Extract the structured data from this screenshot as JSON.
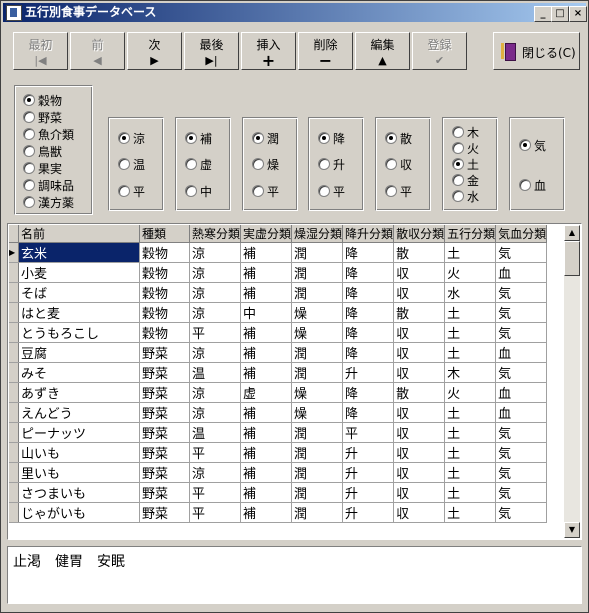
{
  "window": {
    "title": "五行別食事データベース"
  },
  "titlebar_buttons": {
    "minimize": "_",
    "maximize": "□",
    "close": "×"
  },
  "toolbar": {
    "first": {
      "label": "最初",
      "icon": "skip-first-icon",
      "disabled": true
    },
    "prev": {
      "label": "前",
      "icon": "prev-icon",
      "disabled": true
    },
    "next": {
      "label": "次",
      "icon": "next-icon",
      "disabled": false
    },
    "last": {
      "label": "最後",
      "icon": "skip-last-icon",
      "disabled": false
    },
    "insert": {
      "label": "挿入",
      "icon": "plus-icon",
      "disabled": false
    },
    "delete": {
      "label": "削除",
      "icon": "minus-icon",
      "disabled": false
    },
    "edit": {
      "label": "編集",
      "icon": "up-triangle-icon",
      "disabled": false
    },
    "save": {
      "label": "登録",
      "icon": "check-icon",
      "disabled": true
    },
    "close": {
      "label": "閉じる(C)",
      "icon": "door-icon"
    }
  },
  "filters": {
    "category": {
      "options": [
        "穀物",
        "野菜",
        "魚介類",
        "鳥獣",
        "果実",
        "調味品",
        "漢方薬"
      ],
      "selected": 0
    },
    "heat": {
      "options": [
        "涼",
        "温",
        "平"
      ],
      "selected": 0
    },
    "tonify": {
      "options": [
        "補",
        "虚",
        "中"
      ],
      "selected": 0
    },
    "moist": {
      "options": [
        "潤",
        "燥",
        "平"
      ],
      "selected": 0
    },
    "rise": {
      "options": [
        "降",
        "升",
        "平"
      ],
      "selected": 0
    },
    "disperse": {
      "options": [
        "散",
        "収",
        "平"
      ],
      "selected": 0
    },
    "five": {
      "options": [
        "木",
        "火",
        "土",
        "金",
        "水"
      ],
      "selected": 2
    },
    "qi": {
      "options": [
        "気",
        "血"
      ],
      "selected": 0
    }
  },
  "table": {
    "columns": [
      "名前",
      "種類",
      "熱寒分類",
      "実虚分類",
      "燥湿分類",
      "降升分類",
      "散収分類",
      "五行分類",
      "気血分類"
    ],
    "rows": [
      [
        "玄米",
        "穀物",
        "涼",
        "補",
        "潤",
        "降",
        "散",
        "土",
        "気"
      ],
      [
        "小麦",
        "穀物",
        "涼",
        "補",
        "潤",
        "降",
        "収",
        "火",
        "血"
      ],
      [
        "そば",
        "穀物",
        "涼",
        "補",
        "潤",
        "降",
        "収",
        "水",
        "気"
      ],
      [
        "はと麦",
        "穀物",
        "涼",
        "中",
        "燥",
        "降",
        "散",
        "土",
        "気"
      ],
      [
        "とうもろこし",
        "穀物",
        "平",
        "補",
        "燥",
        "降",
        "収",
        "土",
        "気"
      ],
      [
        "豆腐",
        "野菜",
        "涼",
        "補",
        "潤",
        "降",
        "収",
        "土",
        "血"
      ],
      [
        "みそ",
        "野菜",
        "温",
        "補",
        "潤",
        "升",
        "収",
        "木",
        "気"
      ],
      [
        "あずき",
        "野菜",
        "涼",
        "虚",
        "燥",
        "降",
        "散",
        "火",
        "血"
      ],
      [
        "えんどう",
        "野菜",
        "涼",
        "補",
        "燥",
        "降",
        "収",
        "土",
        "血"
      ],
      [
        "ピーナッツ",
        "野菜",
        "温",
        "補",
        "潤",
        "平",
        "収",
        "土",
        "気"
      ],
      [
        "山いも",
        "野菜",
        "平",
        "補",
        "潤",
        "升",
        "収",
        "土",
        "気"
      ],
      [
        "里いも",
        "野菜",
        "涼",
        "補",
        "潤",
        "升",
        "収",
        "土",
        "気"
      ],
      [
        "さつまいも",
        "野菜",
        "平",
        "補",
        "潤",
        "升",
        "収",
        "土",
        "気"
      ],
      [
        "じゃがいも",
        "野菜",
        "平",
        "補",
        "潤",
        "升",
        "収",
        "土",
        "気"
      ]
    ],
    "selected_row": 0
  },
  "memo": {
    "text": "止渇　健胃　安眠"
  },
  "colors": {
    "titlebar_start": "#0a246a",
    "titlebar_end": "#a6caf0",
    "face": "#d4d0c8",
    "selection": "#0a246a"
  }
}
